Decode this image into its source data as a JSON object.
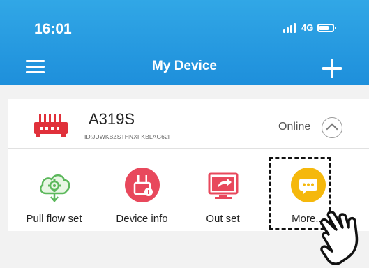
{
  "status_bar": {
    "time": "16:01",
    "network": "4G"
  },
  "header": {
    "title": "My Device"
  },
  "device": {
    "name": "A319S",
    "id": "ID:JUWKBZSTHNXFKBLAG62F",
    "status": "Online"
  },
  "actions": [
    {
      "label": "Pull flow set",
      "icon": "cloud-gear-icon",
      "color": "#5cb85c"
    },
    {
      "label": "Device info",
      "icon": "router-info-icon",
      "color": "#e8485c"
    },
    {
      "label": "Out set",
      "icon": "screen-share-icon",
      "color": "#e8485c"
    },
    {
      "label": "More...",
      "icon": "more-dots-icon",
      "color": "#f5b80c"
    }
  ],
  "colors": {
    "header": "#1e8fdb",
    "accent_red": "#e0303a"
  }
}
